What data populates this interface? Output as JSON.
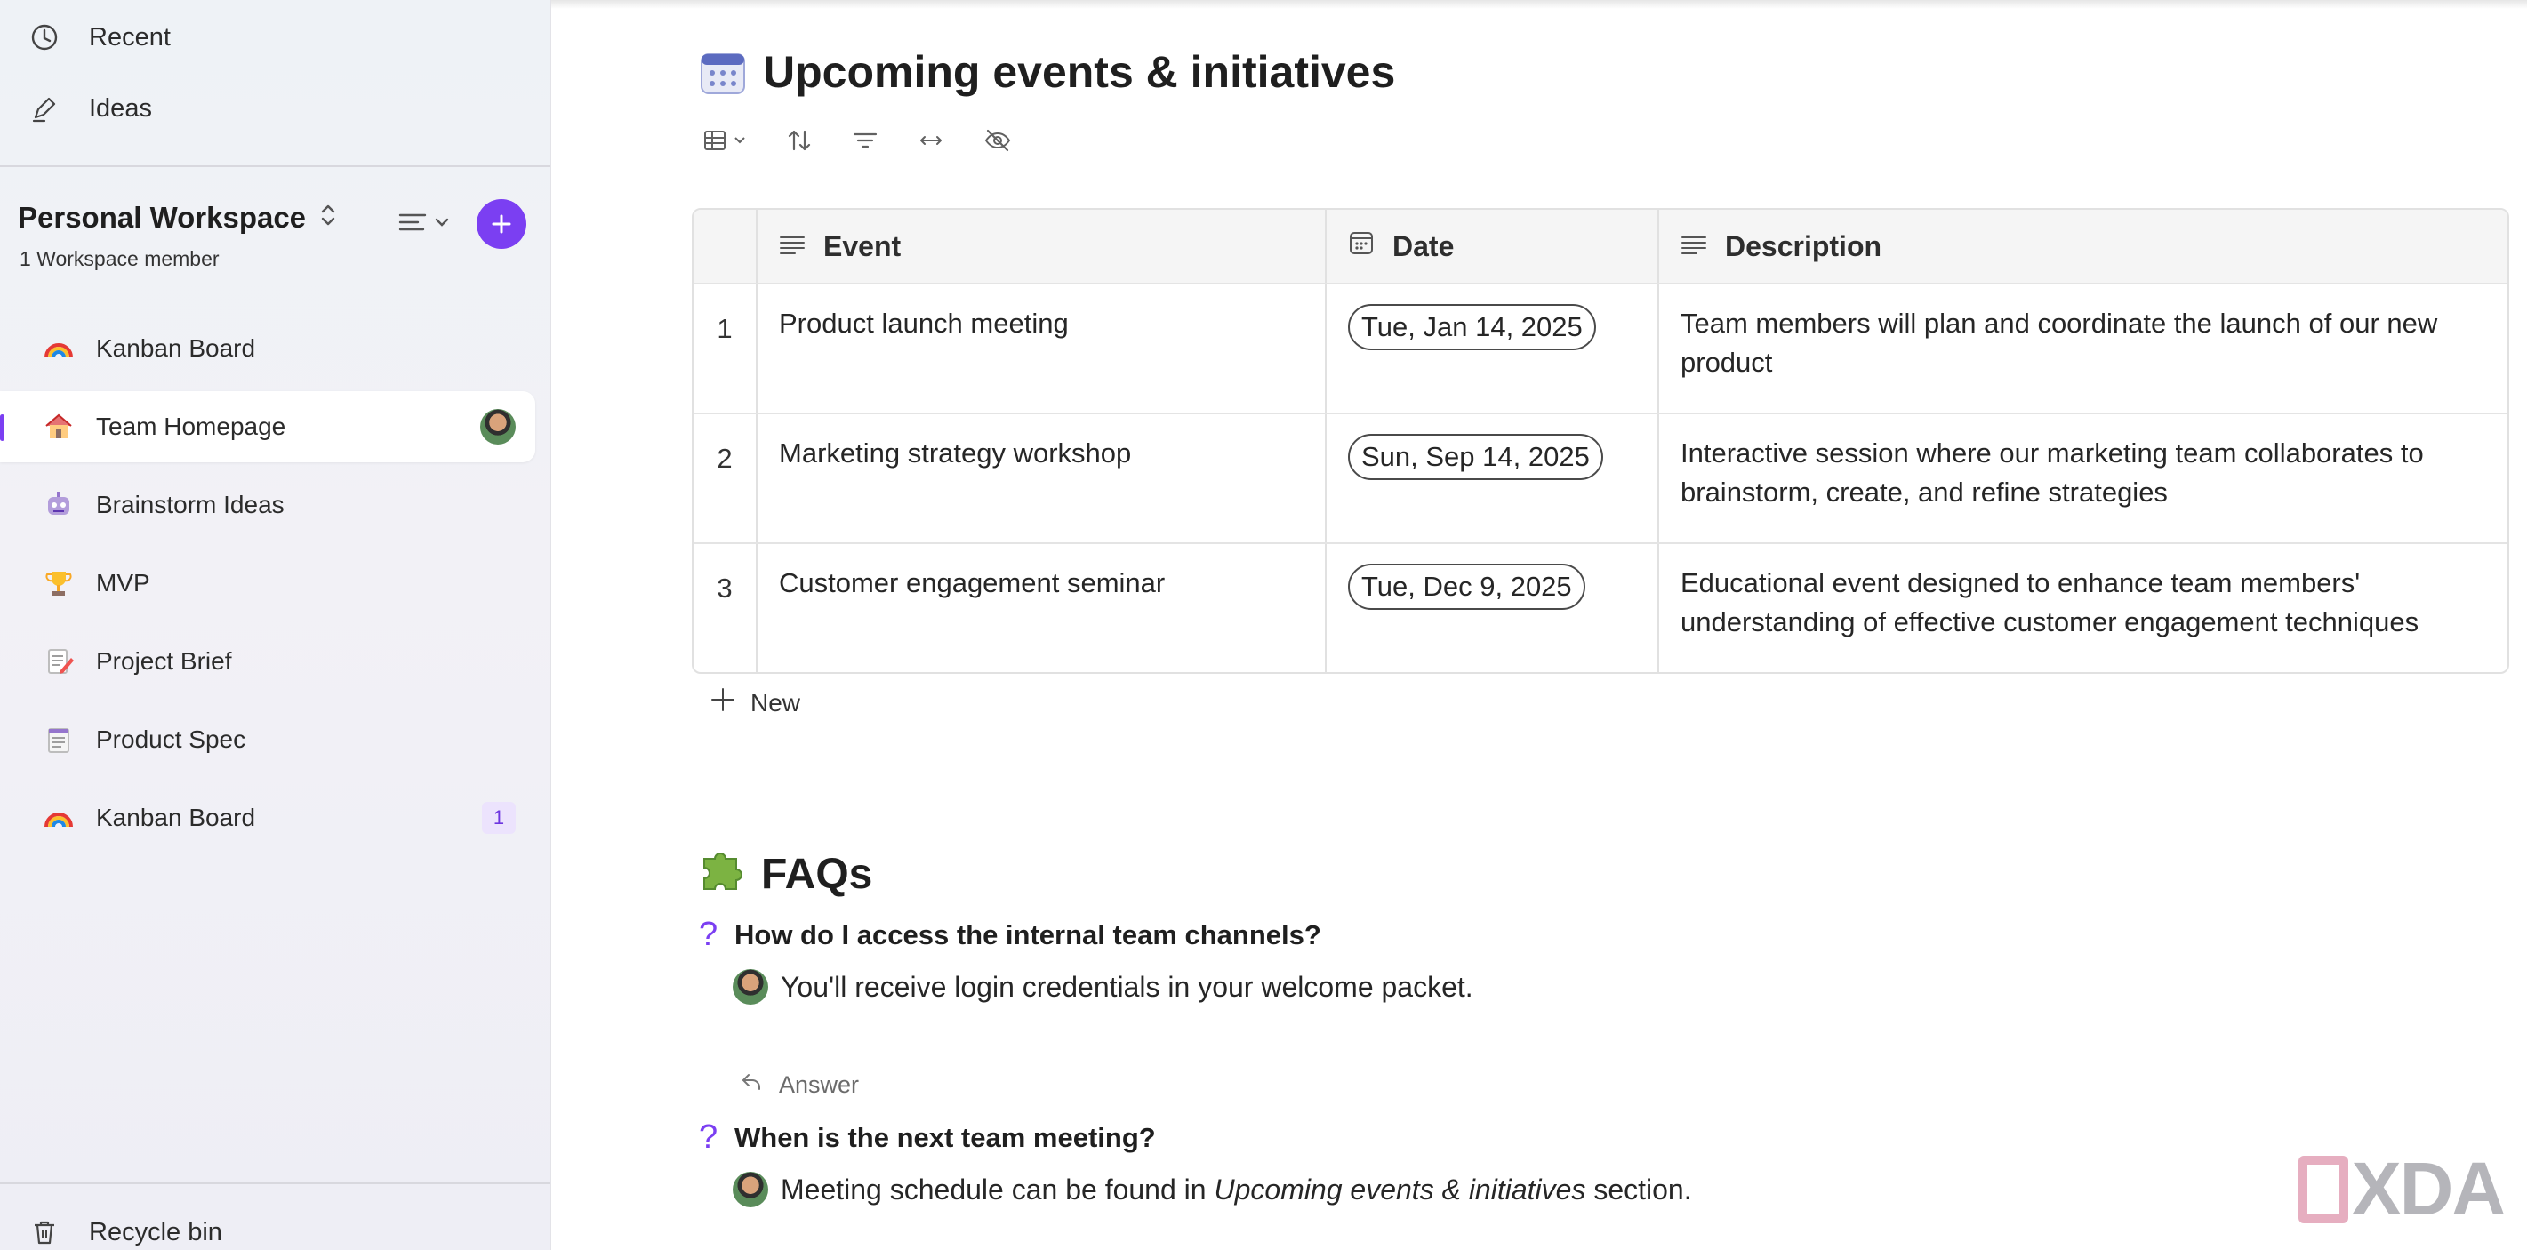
{
  "sidebar": {
    "top_items": [
      {
        "label": "Recent",
        "icon": "clock-icon"
      },
      {
        "label": "Ideas",
        "icon": "pencil-icon"
      }
    ],
    "workspace": {
      "title": "Personal Workspace",
      "subtitle": "1 Workspace member"
    },
    "pages": [
      {
        "label": "Kanban Board",
        "icon": "rainbow-icon"
      },
      {
        "label": "Team Homepage",
        "icon": "house-icon",
        "active": true
      },
      {
        "label": "Brainstorm Ideas",
        "icon": "robot-icon"
      },
      {
        "label": "MVP",
        "icon": "trophy-icon"
      },
      {
        "label": "Project Brief",
        "icon": "memo-icon"
      },
      {
        "label": "Product Spec",
        "icon": "notepad-icon"
      },
      {
        "label": "Kanban Board",
        "icon": "rainbow-icon",
        "badge": "1"
      }
    ],
    "recycle_bin": "Recycle bin"
  },
  "main": {
    "events_title": "Upcoming events & initiatives",
    "table": {
      "columns": [
        "Event",
        "Date",
        "Description"
      ],
      "rows": [
        {
          "num": "1",
          "event": "Product launch meeting",
          "date": "Tue, Jan 14, 2025",
          "description": "Team members will plan and coordinate the launch of our new product"
        },
        {
          "num": "2",
          "event": "Marketing strategy workshop",
          "date": "Sun, Sep 14, 2025",
          "description": "Interactive session where our marketing team collaborates to brainstorm, create, and refine strategies"
        },
        {
          "num": "3",
          "event": "Customer engagement seminar",
          "date": "Tue, Dec 9, 2025",
          "description": "Educational event designed to enhance team members' understanding of effective customer engagement techniques"
        }
      ],
      "new_label": "New"
    },
    "faq_title": "FAQs",
    "faqs": [
      {
        "question": "How do I access the internal team channels?",
        "answer": "You'll receive login credentials in your welcome packet."
      },
      {
        "question": "When is the next team meeting?",
        "answer_prefix": "Meeting schedule can be found in ",
        "answer_em": "Upcoming events & initiatives",
        "answer_suffix": " section."
      }
    ],
    "answer_button": "Answer"
  },
  "watermark": "XDA",
  "colors": {
    "accent": "#7b3ff2",
    "sidebar_bg": "#eff1f6"
  }
}
